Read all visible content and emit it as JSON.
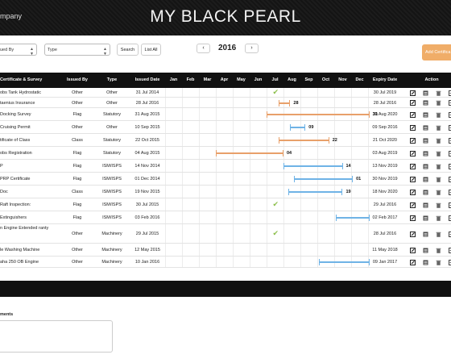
{
  "header": {
    "company": "mpany",
    "title": "MY BLACK PEARL"
  },
  "filters": {
    "issued_by_select": "ued By",
    "type_select": "Type",
    "search_label": "Search",
    "list_all_label": "List All",
    "prev_label": "‹",
    "next_label": "›",
    "year": "2016",
    "add_certificate_label": "Add Certifica"
  },
  "table": {
    "columns": {
      "certificate": "Certificate & Survey",
      "issued_by": "Issued By",
      "type": "Type",
      "issued_date": "Issued Date",
      "months": [
        "Jan",
        "Feb",
        "Mar",
        "Apr",
        "May",
        "Jun",
        "Jul",
        "Aug",
        "Sep",
        "Oct",
        "Nov",
        "Dec"
      ],
      "expiry_date": "Expiry Date",
      "action": "Action"
    },
    "rows": [
      {
        "name": "obs Tank Hydrostatic",
        "issued_by": "Other",
        "type": "Other",
        "issued_date": "31 Jul 2014",
        "expiry_date": "30 Jul 2019",
        "timeline": {
          "kind": "check",
          "month": 7
        }
      },
      {
        "name": "taenius Insurance",
        "issued_by": "Other",
        "type": "Other",
        "issued_date": "28 Jul 2016",
        "expiry_date": "28 Jul 2016",
        "timeline": {
          "kind": "bar",
          "color": "orange",
          "start": 6.7,
          "end": 7.4,
          "label": "28"
        }
      },
      {
        "name": "Docking Survey",
        "issued_by": "Flag",
        "type": "Statutory",
        "issued_date": "31 Aug 2015",
        "expiry_date": "30 Aug 2020",
        "timeline": {
          "kind": "bar",
          "color": "orange",
          "start": 6.0,
          "end": 12.9,
          "label": "31"
        }
      },
      {
        "name": "Cruising Permit",
        "issued_by": "Other",
        "type": "Other",
        "issued_date": "10 Sep 2015",
        "expiry_date": "09 Sep 2016",
        "timeline": {
          "kind": "bar",
          "color": "blue",
          "start": 7.4,
          "end": 8.3,
          "label": "09"
        }
      },
      {
        "name": "tificate of Class",
        "issued_by": "Class",
        "type": "Statutory",
        "issued_date": "22 Oct 2015",
        "expiry_date": "21 Oct 2020",
        "timeline": {
          "kind": "bar",
          "color": "orange",
          "start": 6.7,
          "end": 9.7,
          "label": "22"
        }
      },
      {
        "name": "obs Registration",
        "issued_by": "Flag",
        "type": "Statutory",
        "issued_date": "04 Aug 2015",
        "expiry_date": "03 Aug 2019",
        "timeline": {
          "kind": "bar",
          "color": "orange",
          "start": 3.0,
          "end": 7.0,
          "label": "04"
        }
      },
      {
        "name": "P",
        "issued_by": "Flag",
        "type": "ISM/ISPS",
        "issued_date": "14 Nov 2014",
        "expiry_date": "13 Nov 2019",
        "timeline": {
          "kind": "bar",
          "color": "blue",
          "start": 7.0,
          "end": 10.5,
          "label": "14"
        }
      },
      {
        "name": "PRP Certificate",
        "issued_by": "Flag",
        "type": "ISM/ISPS",
        "issued_date": "01 Dec 2014",
        "expiry_date": "30 Nov 2019",
        "timeline": {
          "kind": "bar",
          "color": "blue",
          "start": 7.6,
          "end": 11.1,
          "label": "01"
        }
      },
      {
        "name": "Doc",
        "issued_by": "Class",
        "type": "ISM/ISPS",
        "issued_date": "19 Nov 2015",
        "expiry_date": "18 Nov 2020",
        "timeline": {
          "kind": "bar",
          "color": "blue",
          "start": 7.3,
          "end": 10.5,
          "label": "19"
        }
      },
      {
        "name": "Raft Inspection:",
        "issued_by": "Flag",
        "type": "ISM/ISPS",
        "issued_date": "30 Jul 2015",
        "expiry_date": "29 Jul 2016",
        "timeline": {
          "kind": "check",
          "month": 7
        }
      },
      {
        "name": "Extinguishers",
        "issued_by": "Flag",
        "type": "ISM/ISPS",
        "issued_date": "03 Feb 2016",
        "expiry_date": "02 Feb 2017",
        "timeline": {
          "kind": "bar",
          "color": "blue",
          "start": 10.1,
          "end": 13.0,
          "label": ""
        }
      },
      {
        "name": "n Engine Extended ranty",
        "issued_by": "Other",
        "type": "Machinery",
        "issued_date": "29 Jul 2015",
        "expiry_date": "28 Jul 2016",
        "timeline": {
          "kind": "check",
          "month": 7
        }
      },
      {
        "name": "le Washing Machine",
        "issued_by": "Other",
        "type": "Machinery",
        "issued_date": "12 May 2015",
        "expiry_date": "11 May 2018",
        "timeline": {
          "kind": "none"
        }
      },
      {
        "name": "aha 250 OB Engine",
        "issued_by": "Other",
        "type": "Machinery",
        "issued_date": "10 Jan 2016",
        "expiry_date": "09 Jan 2017",
        "timeline": {
          "kind": "bar",
          "color": "blue",
          "start": 9.1,
          "end": 13.0,
          "label": ""
        }
      }
    ]
  },
  "comments": {
    "label": "ments"
  },
  "colors": {
    "orange": "#e8a06a",
    "blue": "#6fb3e6",
    "check": "#8cbf4b",
    "header_bg": "#111111",
    "add_button": "#f0ad68"
  }
}
